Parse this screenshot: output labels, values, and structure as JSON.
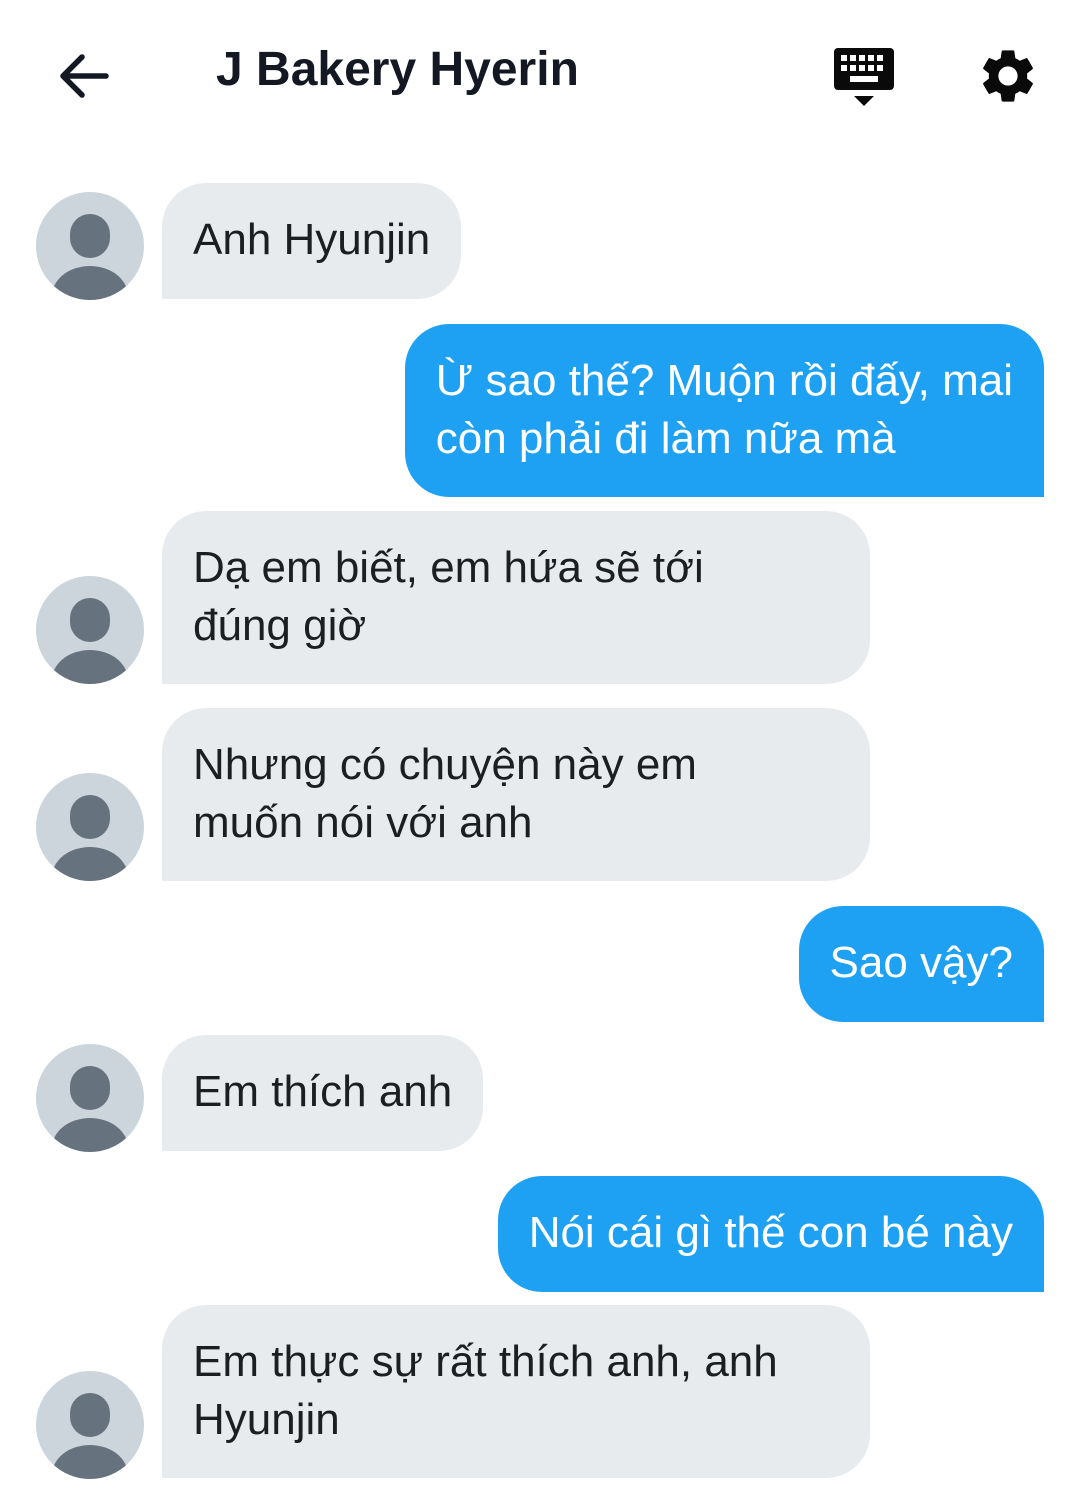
{
  "header": {
    "title": "J Bakery Hyerin",
    "back_icon": "arrow-left-icon",
    "keyboard_icon": "keyboard-icon",
    "settings_icon": "gear-icon"
  },
  "colors": {
    "incoming_bubble": "#e8ebee",
    "outgoing_bubble": "#1ea1f2",
    "avatar_bg": "#ccd5dc",
    "avatar_fg": "#66737f"
  },
  "messages": [
    {
      "from": "them",
      "text": "Anh Hyunjin"
    },
    {
      "from": "me",
      "text": "Ừ sao thế? Muộn rồi đấy, mai\ncòn phải đi làm nữa mà"
    },
    {
      "from": "them",
      "text": "Dạ em biết, em hứa sẽ tới\nđúng giờ"
    },
    {
      "from": "them",
      "text": "Nhưng có chuyện này em\nmuốn nói với anh"
    },
    {
      "from": "me",
      "text": "Sao vậy?"
    },
    {
      "from": "them",
      "text": "Em thích anh"
    },
    {
      "from": "me",
      "text": "Nói cái gì thế con bé này"
    },
    {
      "from": "them",
      "text": "Em thực sự rất thích anh, anh\nHyunjin"
    }
  ]
}
